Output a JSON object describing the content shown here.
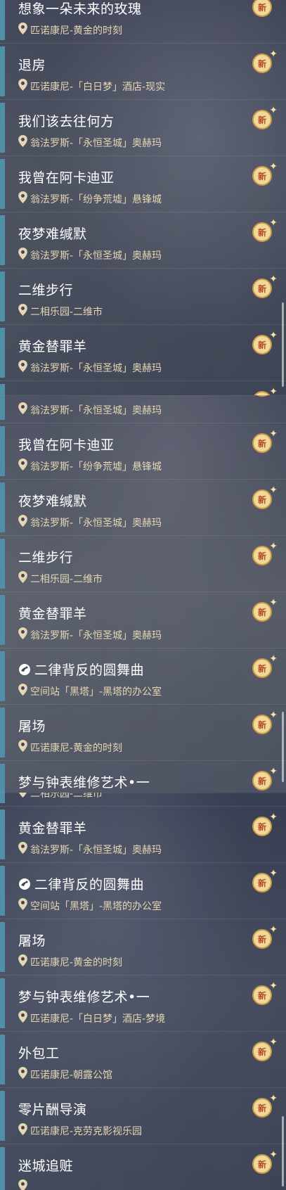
{
  "badge_text": "新",
  "panels": [
    {
      "items": [
        {
          "title": "想象一朵未来的玫瑰",
          "location": "匹诺康尼-黄金的时刻",
          "game_icon": false
        },
        {
          "title": "退房",
          "location": "匹诺康尼-「白日梦」酒店-现实",
          "game_icon": false
        },
        {
          "title": "我们该去往何方",
          "location": "翁法罗斯-「永恒圣城」奥赫玛",
          "game_icon": false
        },
        {
          "title": "我曾在阿卡迪亚",
          "location": "翁法罗斯-「纷争荒墟」悬锋城",
          "game_icon": false
        },
        {
          "title": "夜梦难缄默",
          "location": "翁法罗斯-「永恒圣城」奥赫玛",
          "game_icon": false
        },
        {
          "title": "二维步行",
          "location": "二相乐园-二维市",
          "game_icon": false
        },
        {
          "title": "黄金替罪羊",
          "location": "翁法罗斯-「永恒圣城」奥赫玛",
          "game_icon": false
        },
        {
          "title": "",
          "location": "翁法罗斯-「永恒圣城」奥赫玛",
          "game_icon": false
        }
      ]
    },
    {
      "items": [
        {
          "title": "",
          "location": "翁法罗斯-「永恒圣城」奥赫玛",
          "game_icon": false
        },
        {
          "title": "我曾在阿卡迪亚",
          "location": "翁法罗斯-「纷争荒墟」悬锋城",
          "game_icon": false
        },
        {
          "title": "夜梦难缄默",
          "location": "翁法罗斯-「永恒圣城」奥赫玛",
          "game_icon": false
        },
        {
          "title": "二维步行",
          "location": "二相乐园-二维市",
          "game_icon": false
        },
        {
          "title": "黄金替罪羊",
          "location": "翁法罗斯-「永恒圣城」奥赫玛",
          "game_icon": false
        },
        {
          "title": "二律背反的圆舞曲",
          "location": "空间站「黑塔」-黑塔的办公室",
          "game_icon": true
        },
        {
          "title": "屠场",
          "location": "匹诺康尼-黄金的时刻",
          "game_icon": false
        },
        {
          "title": "梦与钟表维修艺术•一",
          "location": "匹诺康尼-「白日梦」酒店-梦境",
          "game_icon": false
        }
      ]
    },
    {
      "items": [
        {
          "title": "",
          "location": "二相乐园-二维市",
          "game_icon": false
        },
        {
          "title": "黄金替罪羊",
          "location": "翁法罗斯-「永恒圣城」奥赫玛",
          "game_icon": false
        },
        {
          "title": "二律背反的圆舞曲",
          "location": "空间站「黑塔」-黑塔的办公室",
          "game_icon": true
        },
        {
          "title": "屠场",
          "location": "匹诺康尼-黄金的时刻",
          "game_icon": false
        },
        {
          "title": "梦与钟表维修艺术•一",
          "location": "匹诺康尼-「白日梦」酒店-梦境",
          "game_icon": false
        },
        {
          "title": "外包工",
          "location": "匹诺康尼-朝露公馆",
          "game_icon": false
        },
        {
          "title": "零片酬导演",
          "location": "匹诺康尼-克劳克影视乐园",
          "game_icon": false
        },
        {
          "title": "迷城追赃",
          "location": "",
          "game_icon": false
        }
      ]
    }
  ]
}
